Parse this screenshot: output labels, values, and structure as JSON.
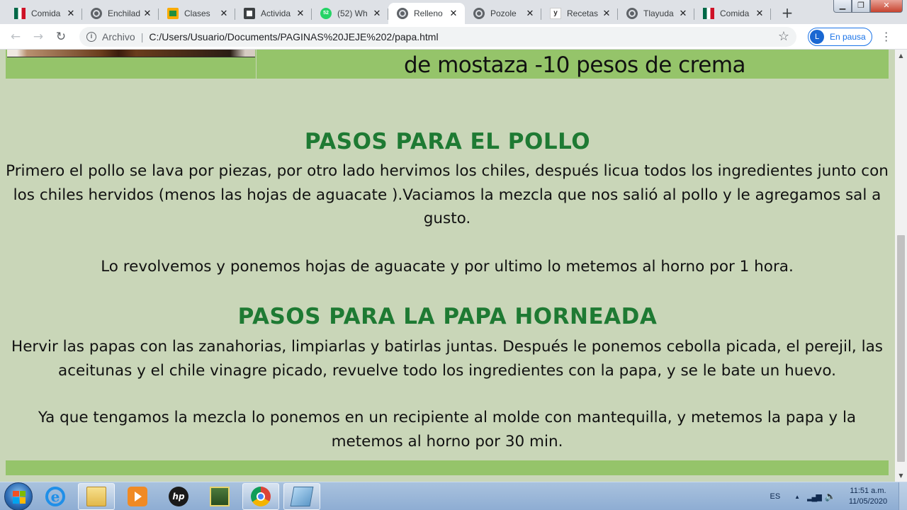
{
  "browser": {
    "tabs": [
      {
        "title": "Comida",
        "favicon": "mexico-flag-icon",
        "active": false
      },
      {
        "title": "Enchilad",
        "favicon": "globe-icon",
        "active": false
      },
      {
        "title": "Clases",
        "favicon": "classroom-icon",
        "active": false
      },
      {
        "title": "Activida",
        "favicon": "activity-icon",
        "active": false
      },
      {
        "title": "(52) Wh",
        "favicon": "whatsapp-icon",
        "badge": "52",
        "active": false
      },
      {
        "title": "Relleno",
        "favicon": "globe-icon",
        "active": true
      },
      {
        "title": "Pozole",
        "favicon": "globe-icon",
        "active": false
      },
      {
        "title": "Recetas",
        "favicon": "yahoo-icon",
        "active": false
      },
      {
        "title": "Tlayuda",
        "favicon": "globe-icon",
        "active": false
      },
      {
        "title": "Comida",
        "favicon": "mexico-flag-icon",
        "active": false
      }
    ],
    "close_glyph": "✕",
    "new_tab_glyph": "+",
    "window_controls": {
      "minimize": "▁",
      "maximize": "❐",
      "close": "✕"
    },
    "nav": {
      "back": "←",
      "forward": "→",
      "reload": "↻"
    },
    "omnibox": {
      "info_glyph": "i",
      "scheme_label": "Archivo",
      "separator": "|",
      "url": "C:/Users/Usuario/Documents/PAGINAS%20JEJE%202/papa.html"
    },
    "bookmark_glyph": "☆",
    "profile": {
      "initial": "L",
      "label": "En pausa"
    },
    "menu_glyph": "⋮"
  },
  "page": {
    "ingredients_line": "de mostaza -10 pesos de crema",
    "sections": [
      {
        "title": "PASOS PARA EL POLLO",
        "paragraphs": [
          "Primero el pollo se lava por piezas, por otro lado hervimos los chiles, después licua todos los ingredientes junto con los chiles hervidos (menos las hojas de aguacate ).Vaciamos la mezcla que nos salió al pollo y le agregamos sal a gusto.",
          "Lo revolvemos y ponemos hojas de aguacate y por ultimo lo metemos al horno por 1 hora."
        ]
      },
      {
        "title": "PASOS PARA LA PAPA HORNEADA",
        "paragraphs": [
          "Hervir las papas con las zanahorias, limpiarlas y batirlas juntas. Después le ponemos cebolla picada, el perejil, las aceitunas y el chile vinagre picado, revuelve todo los ingredientes con la papa, y se le bate un huevo.",
          "Ya que tengamos la mezcla lo ponemos en un recipiente al molde con mantequilla, y metemos la papa y la metemos al horno por 30 min."
        ]
      }
    ],
    "colors": {
      "background": "#c9d6b8",
      "band": "#95c46a",
      "heading": "#1e7a33",
      "text": "#111111"
    }
  },
  "scrollbar": {
    "up_glyph": "▲",
    "down_glyph": "▼",
    "position_fraction": 0.84
  },
  "taskbar": {
    "apps": [
      {
        "name": "internet-explorer-icon",
        "glyph": "e"
      },
      {
        "name": "file-explorer-icon",
        "glyph": ""
      },
      {
        "name": "media-player-icon",
        "glyph": ""
      },
      {
        "name": "hp-icon",
        "glyph": "hp"
      },
      {
        "name": "task-manager-icon",
        "glyph": ""
      },
      {
        "name": "chrome-icon",
        "glyph": ""
      },
      {
        "name": "notes-icon",
        "glyph": ""
      }
    ],
    "tray": {
      "language": "ES",
      "expand_glyph": "▲",
      "network_glyph": "▂▄▆",
      "volume_glyph": "🔈",
      "time": "11:51 a.m.",
      "date": "11/05/2020"
    }
  }
}
